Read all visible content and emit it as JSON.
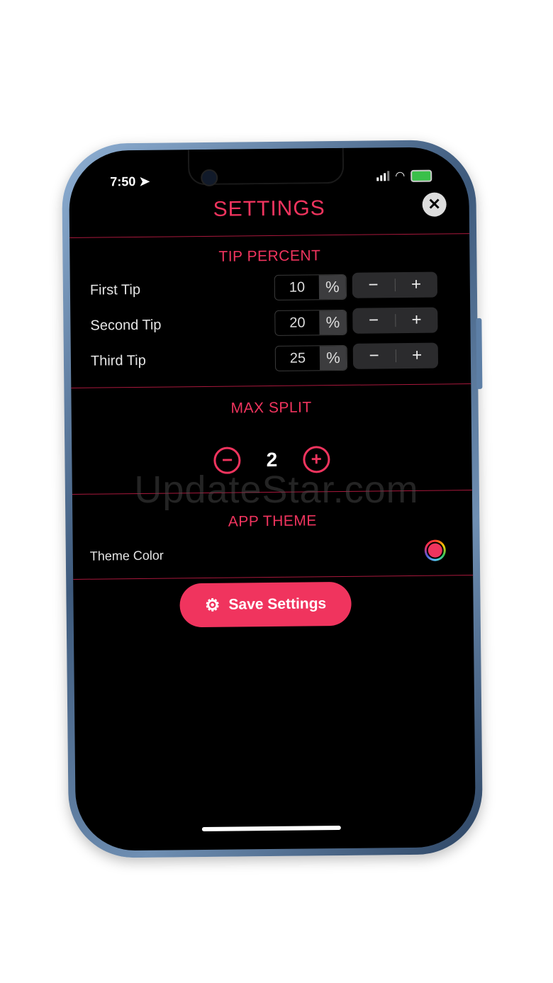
{
  "status": {
    "time": "7:50"
  },
  "header": {
    "title": "SETTINGS",
    "close_icon": "close-icon"
  },
  "tip_section": {
    "heading": "TIP PERCENT",
    "rows": [
      {
        "label": "First Tip",
        "value": "10",
        "unit": "%",
        "minus": "−",
        "plus": "+"
      },
      {
        "label": "Second Tip",
        "value": "20",
        "unit": "%",
        "minus": "−",
        "plus": "+"
      },
      {
        "label": "Third Tip",
        "value": "25",
        "unit": "%",
        "minus": "−",
        "plus": "+"
      }
    ]
  },
  "split_section": {
    "heading": "MAX SPLIT",
    "value": "2",
    "minus": "−",
    "plus": "+"
  },
  "theme_section": {
    "heading": "APP THEME",
    "label": "Theme Color",
    "color": "#f0345e"
  },
  "save": {
    "label": "Save Settings",
    "icon": "gear-icon"
  },
  "watermark": "UpdateStar.com",
  "colors": {
    "accent": "#f0345e",
    "background": "#000000"
  }
}
